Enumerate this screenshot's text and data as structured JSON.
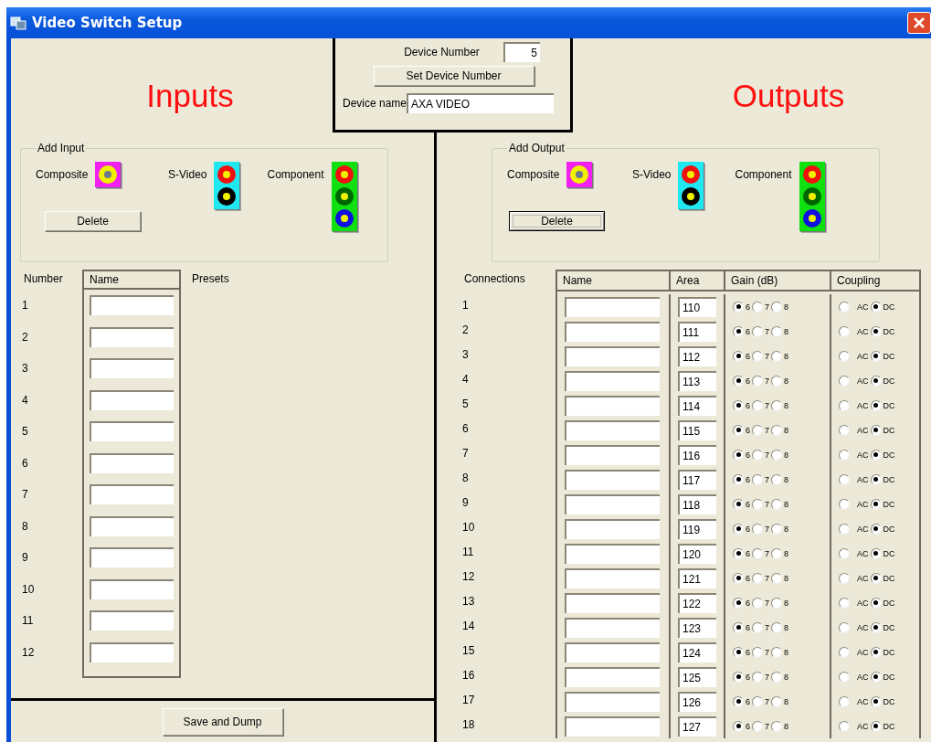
{
  "window": {
    "title": "Video Switch Setup"
  },
  "device": {
    "number_label": "Device Number",
    "number": "5",
    "set_button": "Set Device Number",
    "name_label": "Device name",
    "name": "AXA VIDEO"
  },
  "inputs": {
    "heading": "Inputs",
    "add_group": {
      "title": "Add Input",
      "connectors": [
        {
          "label": "Composite",
          "kind": "composite"
        },
        {
          "label": "S-Video",
          "kind": "svideo"
        },
        {
          "label": "Component",
          "kind": "component"
        }
      ],
      "delete_button": {
        "label": "Delete",
        "focused": false
      }
    },
    "columns": [
      "Number",
      "Name",
      "Presets"
    ],
    "rows": [
      {
        "number": "1"
      },
      {
        "number": "2"
      },
      {
        "number": "3"
      },
      {
        "number": "4"
      },
      {
        "number": "5"
      },
      {
        "number": "6"
      },
      {
        "number": "7"
      },
      {
        "number": "8"
      },
      {
        "number": "9"
      },
      {
        "number": "10"
      },
      {
        "number": "11"
      },
      {
        "number": "12"
      }
    ]
  },
  "outputs": {
    "heading": "Outputs",
    "add_group": {
      "title": "Add Output",
      "connectors": [
        {
          "label": "Composite",
          "kind": "composite"
        },
        {
          "label": "S-Video",
          "kind": "svideo"
        },
        {
          "label": "Component",
          "kind": "component"
        }
      ],
      "delete_button": {
        "label": "Delete",
        "focused": true
      }
    },
    "columns": [
      "Connections",
      "Name",
      "Area",
      "Gain (dB)",
      "Coupling"
    ],
    "rows": [
      {
        "number": "1",
        "area": "110",
        "gain": [
          {
            "label": "6",
            "selected": true
          },
          {
            "label": "7",
            "selected": false
          },
          {
            "label": "8",
            "selected": false
          }
        ],
        "coupling": [
          {
            "label": "AC",
            "selected": false
          },
          {
            "label": "DC",
            "selected": true
          }
        ]
      },
      {
        "number": "2",
        "area": "111",
        "gain": [
          {
            "label": "6",
            "selected": true
          },
          {
            "label": "7",
            "selected": false
          },
          {
            "label": "8",
            "selected": false
          }
        ],
        "coupling": [
          {
            "label": "AC",
            "selected": false
          },
          {
            "label": "DC",
            "selected": true
          }
        ]
      },
      {
        "number": "3",
        "area": "112",
        "gain": [
          {
            "label": "6",
            "selected": true
          },
          {
            "label": "7",
            "selected": false
          },
          {
            "label": "8",
            "selected": false
          }
        ],
        "coupling": [
          {
            "label": "AC",
            "selected": false
          },
          {
            "label": "DC",
            "selected": true
          }
        ]
      },
      {
        "number": "4",
        "area": "113",
        "gain": [
          {
            "label": "6",
            "selected": true
          },
          {
            "label": "7",
            "selected": false
          },
          {
            "label": "8",
            "selected": false
          }
        ],
        "coupling": [
          {
            "label": "AC",
            "selected": false
          },
          {
            "label": "DC",
            "selected": true
          }
        ]
      },
      {
        "number": "5",
        "area": "114",
        "gain": [
          {
            "label": "6",
            "selected": true
          },
          {
            "label": "7",
            "selected": false
          },
          {
            "label": "8",
            "selected": false
          }
        ],
        "coupling": [
          {
            "label": "AC",
            "selected": false
          },
          {
            "label": "DC",
            "selected": true
          }
        ]
      },
      {
        "number": "6",
        "area": "115",
        "gain": [
          {
            "label": "6",
            "selected": true
          },
          {
            "label": "7",
            "selected": false
          },
          {
            "label": "8",
            "selected": false
          }
        ],
        "coupling": [
          {
            "label": "AC",
            "selected": false
          },
          {
            "label": "DC",
            "selected": true
          }
        ]
      },
      {
        "number": "7",
        "area": "116",
        "gain": [
          {
            "label": "6",
            "selected": true
          },
          {
            "label": "7",
            "selected": false
          },
          {
            "label": "8",
            "selected": false
          }
        ],
        "coupling": [
          {
            "label": "AC",
            "selected": false
          },
          {
            "label": "DC",
            "selected": true
          }
        ]
      },
      {
        "number": "8",
        "area": "117",
        "gain": [
          {
            "label": "6",
            "selected": true
          },
          {
            "label": "7",
            "selected": false
          },
          {
            "label": "8",
            "selected": false
          }
        ],
        "coupling": [
          {
            "label": "AC",
            "selected": false
          },
          {
            "label": "DC",
            "selected": true
          }
        ]
      },
      {
        "number": "9",
        "area": "118",
        "gain": [
          {
            "label": "6",
            "selected": true
          },
          {
            "label": "7",
            "selected": false
          },
          {
            "label": "8",
            "selected": false
          }
        ],
        "coupling": [
          {
            "label": "AC",
            "selected": false
          },
          {
            "label": "DC",
            "selected": true
          }
        ]
      },
      {
        "number": "10",
        "area": "119",
        "gain": [
          {
            "label": "6",
            "selected": true
          },
          {
            "label": "7",
            "selected": false
          },
          {
            "label": "8",
            "selected": false
          }
        ],
        "coupling": [
          {
            "label": "AC",
            "selected": false
          },
          {
            "label": "DC",
            "selected": true
          }
        ]
      },
      {
        "number": "11",
        "area": "120",
        "gain": [
          {
            "label": "6",
            "selected": true
          },
          {
            "label": "7",
            "selected": false
          },
          {
            "label": "8",
            "selected": false
          }
        ],
        "coupling": [
          {
            "label": "AC",
            "selected": false
          },
          {
            "label": "DC",
            "selected": true
          }
        ]
      },
      {
        "number": "12",
        "area": "121",
        "gain": [
          {
            "label": "6",
            "selected": true
          },
          {
            "label": "7",
            "selected": false
          },
          {
            "label": "8",
            "selected": false
          }
        ],
        "coupling": [
          {
            "label": "AC",
            "selected": false
          },
          {
            "label": "DC",
            "selected": true
          }
        ]
      },
      {
        "number": "13",
        "area": "122",
        "gain": [
          {
            "label": "6",
            "selected": true
          },
          {
            "label": "7",
            "selected": false
          },
          {
            "label": "8",
            "selected": false
          }
        ],
        "coupling": [
          {
            "label": "AC",
            "selected": false
          },
          {
            "label": "DC",
            "selected": true
          }
        ]
      },
      {
        "number": "14",
        "area": "123",
        "gain": [
          {
            "label": "6",
            "selected": true
          },
          {
            "label": "7",
            "selected": false
          },
          {
            "label": "8",
            "selected": false
          }
        ],
        "coupling": [
          {
            "label": "AC",
            "selected": false
          },
          {
            "label": "DC",
            "selected": true
          }
        ]
      },
      {
        "number": "15",
        "area": "124",
        "gain": [
          {
            "label": "6",
            "selected": true
          },
          {
            "label": "7",
            "selected": false
          },
          {
            "label": "8",
            "selected": false
          }
        ],
        "coupling": [
          {
            "label": "AC",
            "selected": false
          },
          {
            "label": "DC",
            "selected": true
          }
        ]
      },
      {
        "number": "16",
        "area": "125",
        "gain": [
          {
            "label": "6",
            "selected": true
          },
          {
            "label": "7",
            "selected": false
          },
          {
            "label": "8",
            "selected": false
          }
        ],
        "coupling": [
          {
            "label": "AC",
            "selected": false
          },
          {
            "label": "DC",
            "selected": true
          }
        ]
      },
      {
        "number": "17",
        "area": "126",
        "gain": [
          {
            "label": "6",
            "selected": true
          },
          {
            "label": "7",
            "selected": false
          },
          {
            "label": "8",
            "selected": false
          }
        ],
        "coupling": [
          {
            "label": "AC",
            "selected": false
          },
          {
            "label": "DC",
            "selected": true
          }
        ]
      },
      {
        "number": "18",
        "area": "127",
        "gain": [
          {
            "label": "6",
            "selected": true
          },
          {
            "label": "7",
            "selected": false
          },
          {
            "label": "8",
            "selected": false
          }
        ],
        "coupling": [
          {
            "label": "AC",
            "selected": false
          },
          {
            "label": "DC",
            "selected": true
          }
        ]
      }
    ]
  },
  "save_button": "Save and Dump"
}
